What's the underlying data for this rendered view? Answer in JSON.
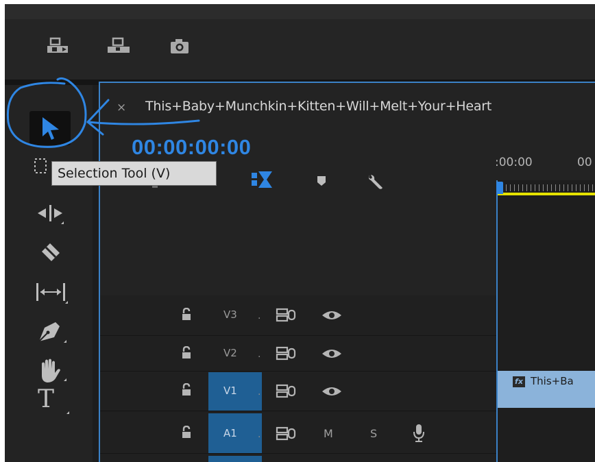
{
  "sequence": {
    "title": "This+Baby+Munchkin+Kitten+Will+Melt+Your+Heart",
    "close_glyph": "×",
    "timecode": "00:00:00:00",
    "ruler": [
      ":00:00",
      "00"
    ]
  },
  "tooltip": {
    "text": "Selection Tool (V)"
  },
  "tracks": [
    {
      "name": "V3",
      "dot": ".",
      "targeted": false
    },
    {
      "name": "V2",
      "dot": ".",
      "targeted": false
    },
    {
      "name": "V1",
      "dot": ".",
      "targeted": true
    },
    {
      "name": "A1",
      "dot": ".",
      "targeted": true,
      "mute": "M",
      "solo": "S"
    }
  ],
  "clip": {
    "fx": "fx",
    "label": "This+Ba"
  },
  "tool_glyphs": {
    "type_tool": "T"
  },
  "colors": {
    "accent": "#2f86e3",
    "panel_border": "#3b82c8",
    "playhead_bar": "#e5e200",
    "annotation": "#2f86e3"
  },
  "icons": [
    "insert-clip-icon",
    "overwrite-clip-icon",
    "export-frame-icon",
    "selection-tool-icon",
    "track-select-icon",
    "ripple-edit-icon",
    "razor-icon",
    "slip-icon",
    "pen-icon",
    "hand-icon",
    "type-tool-icon",
    "snap-icon",
    "marker-icon",
    "wrench-icon",
    "lock-icon",
    "sync-icon",
    "eye-icon",
    "microphone-icon"
  ]
}
